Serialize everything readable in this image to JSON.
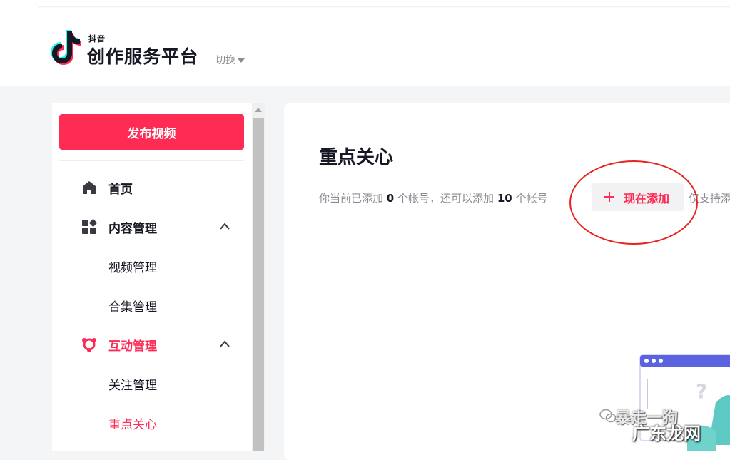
{
  "header": {
    "brand_small": "抖音",
    "brand_name": "创作服务平台",
    "switch_label": "切换"
  },
  "sidebar": {
    "publish_button": "发布视频",
    "items": [
      {
        "label": "首页",
        "icon": "home-icon"
      },
      {
        "label": "内容管理",
        "icon": "grid-apps-icon",
        "expanded": true,
        "children": [
          "视频管理",
          "合集管理"
        ]
      },
      {
        "label": "互动管理",
        "icon": "interaction-icon",
        "expanded": true,
        "active": true,
        "children": [
          "关注管理",
          "重点关心"
        ]
      }
    ],
    "active_child": "重点关心"
  },
  "main": {
    "title": "重点关心",
    "info_prefix": "你当前已添加",
    "added_count": "0",
    "info_mid": "个帐号，还可以添加",
    "remaining_count": "10",
    "info_suffix": "个帐号",
    "add_button": "现在添加",
    "tail_text": "仅支持添"
  },
  "watermark": {
    "line1": "暴走一狗",
    "line2": "广东龙网"
  },
  "colors": {
    "accent": "#fe2c55",
    "annotation": "#e8231f",
    "text": "#161823",
    "muted": "#8a8b91"
  }
}
